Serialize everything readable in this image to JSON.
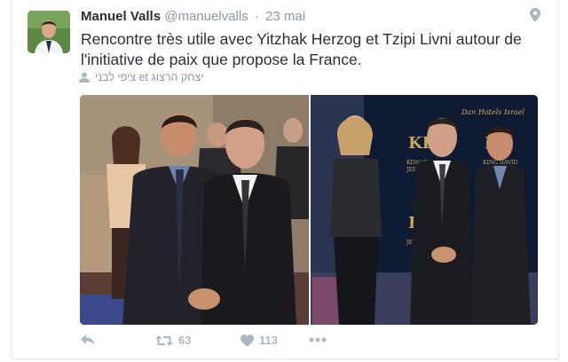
{
  "tweet": {
    "author_name": "Manuel Valls",
    "handle": "@manuelvalls",
    "separator": "·",
    "time": "23 mai",
    "text": "Rencontre très utile avec Yitzhak Herzog et Tzipi Livni autour de l'initiative de paix que propose la France.",
    "tagged": "ציפי לבני et יצחק הרצוג"
  },
  "actions": {
    "retweet_count": "63",
    "like_count": "113"
  },
  "photo_text": {
    "hotel_brand": "Dan Hotels Israel",
    "logo_letters": "KD",
    "hotel_name": "KING DAVID",
    "city": "JERUSALEM"
  },
  "colors": {
    "name": "#292f33",
    "meta": "#8899a6",
    "icons": "#aab8c2",
    "border": "#e1e8ed"
  }
}
